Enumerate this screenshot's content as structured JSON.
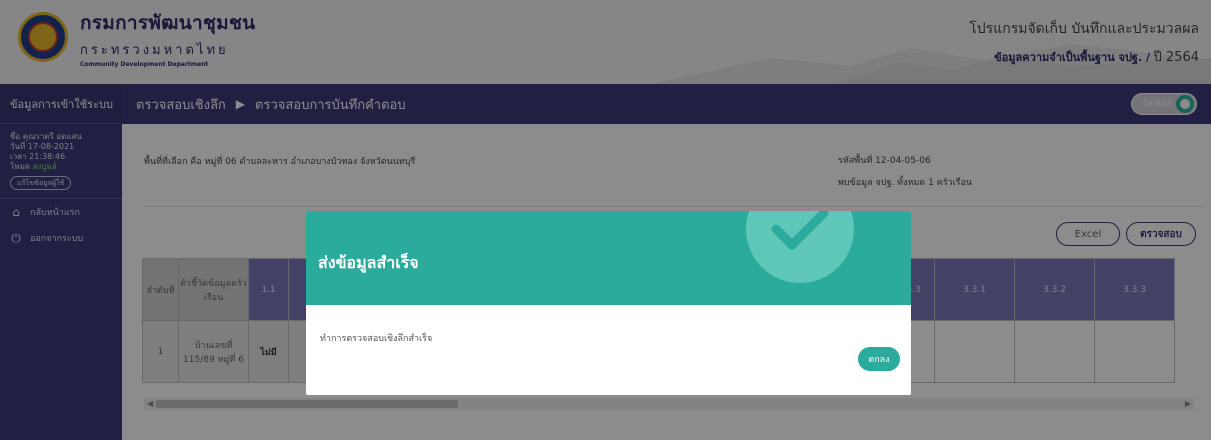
{
  "header": {
    "org_name_th": "กรมการพัฒนาชุมชน",
    "ministry_th": "กระทรวงมหาดไทย",
    "org_name_en": "Community Development Department",
    "program_title": "โปรแกรมจัดเก็บ บันทึกและประมวลผล",
    "program_subtitle": "ข้อมูลความจำเป็นพื้นฐาน จปฐ. /",
    "year": "ปี 2564"
  },
  "sidebar": {
    "title": "ข้อมูลการเข้าใช้ระบบ",
    "user_name": "ชื่อ คุณราตรี อดแสน",
    "date": "วันที่ 17-08-2021",
    "time": "เวลา 21:38:46",
    "mode_label": "โหมด",
    "mode_value": "ลงบูมล์",
    "edit_label": "แก้ไขข้อมูลผู้ใช้",
    "items": [
      {
        "label": "กลับหน้าแรก",
        "icon": "home-icon"
      },
      {
        "label": "ออกจากระบบ",
        "icon": "power-icon"
      }
    ]
  },
  "breadcrumb": {
    "section": "ตรวจสอบเชิงลึก",
    "page": "ตรวจสอบการบันทึกคำตอบ"
  },
  "status": {
    "label": "Online"
  },
  "content": {
    "area_text": "พื้นที่ที่เลือก คือ หมู่ที่ 06 ตำบลละหาร อำเภอบางบัวทอง จังหวัดนนทบุรี",
    "area_code": "รหัสพื้นที่ 12-04-05-06",
    "found_text": "พบข้อมูล จปฐ. ทั้งหมด 1 ครัวเรือน",
    "excel_label": "Excel",
    "check_label": "ตรวจสอบ"
  },
  "table": {
    "headers": {
      "seq": "ลำดับที่",
      "indicator": "ตัวชี้วัดข้อมูลครัวเรือน",
      "c1": "1.1",
      "c2": "3.3",
      "c3": "3.3.1",
      "c4": "3.3.2",
      "c5": "3.3.3"
    },
    "rows": [
      {
        "seq": "1",
        "house": "บ้านเลขที่",
        "addr": "115/89 หมู่ที่ 6",
        "c1": "ไม่มี"
      }
    ]
  },
  "modal": {
    "title": "ส่งข้อมูลสำเร็จ",
    "message": "ทำการตรวจสอบเชิงลึกสำเร็จ",
    "ok_label": "ตกลง"
  },
  "colors": {
    "brand": "#3d3a78",
    "success": "#2bab9b",
    "table_header": "#7a77b8"
  }
}
